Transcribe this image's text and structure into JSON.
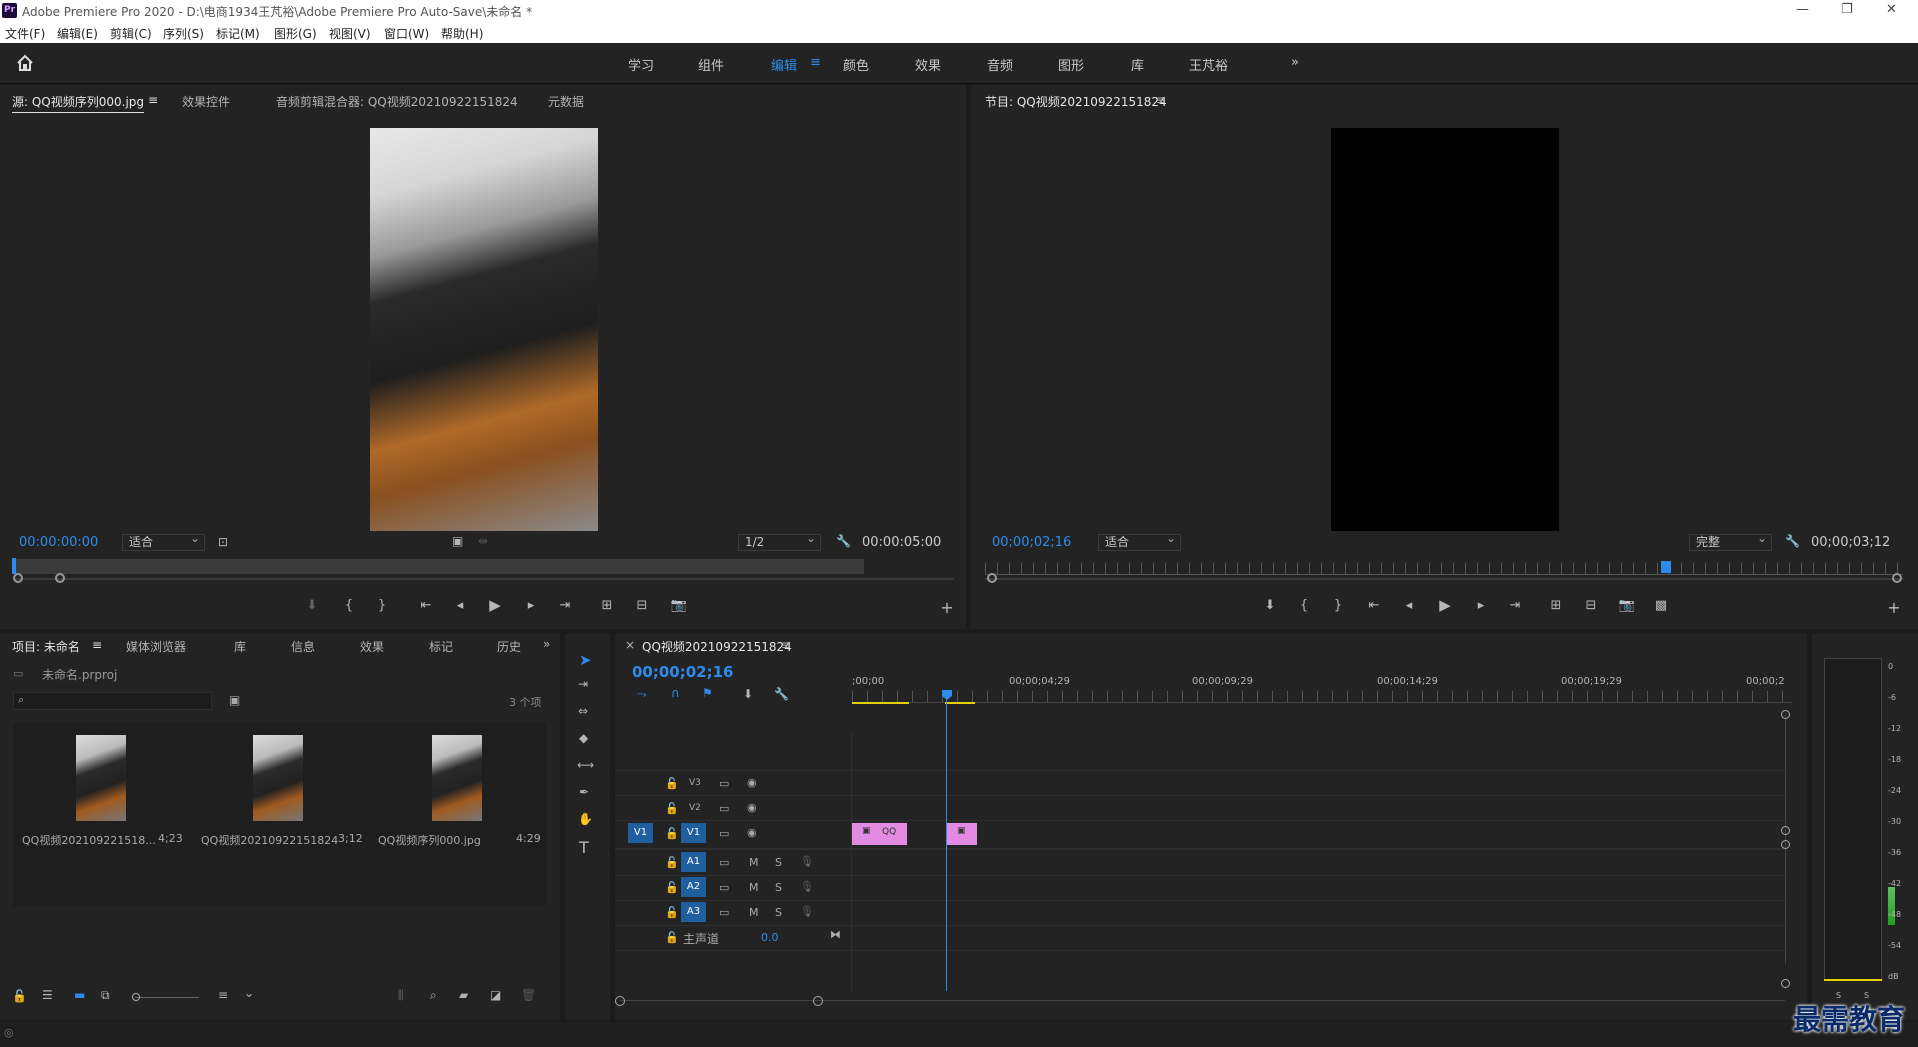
{
  "titlebar": {
    "logo": "Pr",
    "title": "Adobe Premiere Pro 2020 - D:\\电商1934王芃裕\\Adobe Premiere Pro Auto-Save\\未命名 *",
    "min": "—",
    "max": "❐",
    "close": "✕"
  },
  "menu": [
    "文件(F)",
    "编辑(E)",
    "剪辑(C)",
    "序列(S)",
    "标记(M)",
    "图形(G)",
    "视图(V)",
    "窗口(W)",
    "帮助(H)"
  ],
  "workspaces": [
    "学习",
    "组件",
    "编辑",
    "颜色",
    "效果",
    "音频",
    "图形",
    "库",
    "王芃裕"
  ],
  "workspace_active": "编辑",
  "source": {
    "tabs": [
      "源: QQ视频序列000.jpg",
      "效果控件",
      "音频剪辑混合器: QQ视频20210922151824",
      "元数据"
    ],
    "timecode_in": "00:00:00:00",
    "fit": "适合",
    "resolution": "1/2",
    "timecode_dur": "00:00:05:00"
  },
  "program": {
    "tab": "节目: QQ视频20210922151824",
    "timecode": "00;00;02;16",
    "fit": "适合",
    "quality": "完整",
    "duration": "00;00;03;12"
  },
  "project": {
    "tabs": [
      "项目: 未命名",
      "媒体浏览器",
      "库",
      "信息",
      "效果",
      "标记",
      "历史"
    ],
    "file": "未命名.prproj",
    "count": "3 个项",
    "items": [
      {
        "name": "QQ视频202109221518...",
        "dur": "4;23"
      },
      {
        "name": "QQ视频20210922151824",
        "dur": "3;12"
      },
      {
        "name": "QQ视频序列000.jpg",
        "dur": "4:29"
      }
    ]
  },
  "timeline": {
    "tab": "QQ视频20210922151824",
    "timecode": "00;00;02;16",
    "ruler": [
      ";00;00",
      "00;00;04;29",
      "00;00;09;29",
      "00;00;14;29",
      "00;00;19;29",
      "00;00;2"
    ],
    "video_tracks": [
      "V3",
      "V2",
      "V1"
    ],
    "src_patch_v": "V1",
    "audio_tracks": [
      "A1",
      "A2",
      "A3"
    ],
    "master_label": "主声道",
    "master_val": "0.0",
    "clip_label": "QQ",
    "m": "M",
    "s": "S"
  },
  "meter": {
    "scale": [
      "0",
      "-6",
      "-12",
      "-18",
      "-24",
      "-30",
      "-36",
      "-42",
      "-48",
      "-54",
      "dB"
    ],
    "solo": [
      "S",
      "S"
    ]
  },
  "watermark": "最需教育",
  "colors": {
    "accent": "#2d8ceb",
    "clip": "#e38ae3",
    "playhead": "#2d8ceb"
  }
}
